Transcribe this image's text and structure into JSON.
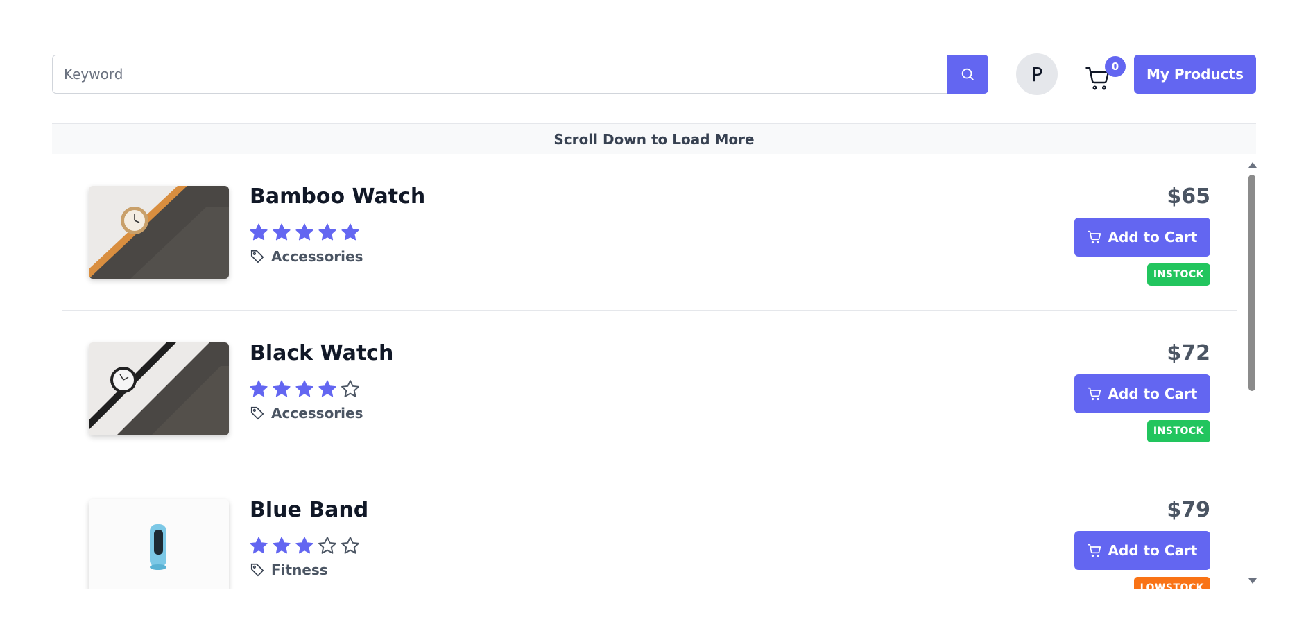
{
  "header": {
    "search_placeholder": "Keyword",
    "avatar_initial": "P",
    "cart_count": "0",
    "my_products_label": "My Products"
  },
  "banner": {
    "text": "Scroll Down to Load More"
  },
  "colors": {
    "accent": "#6366f1",
    "instock": "#22c55e",
    "lowstock": "#f97316"
  },
  "products": [
    {
      "name": "Bamboo Watch",
      "rating": 5,
      "category": "Accessories",
      "price": "$65",
      "add_label": "Add to Cart",
      "status": "INSTOCK",
      "image": "bamboo-watch"
    },
    {
      "name": "Black Watch",
      "rating": 4,
      "category": "Accessories",
      "price": "$72",
      "add_label": "Add to Cart",
      "status": "INSTOCK",
      "image": "black-watch"
    },
    {
      "name": "Blue Band",
      "rating": 3,
      "category": "Fitness",
      "price": "$79",
      "add_label": "Add to Cart",
      "status": "LOWSTOCK",
      "image": "blue-band"
    }
  ]
}
